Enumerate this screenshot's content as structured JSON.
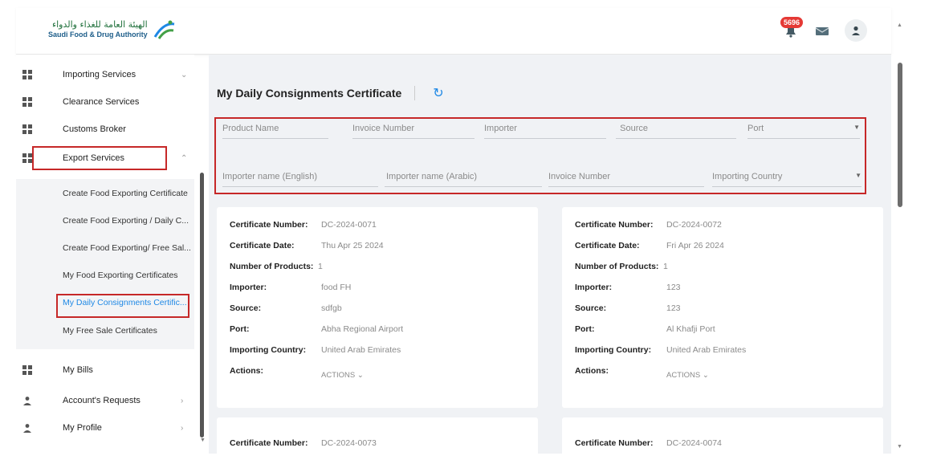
{
  "header": {
    "logo_ar": "الهيئة العامة للغذاء والدواء",
    "logo_en": "Saudi Food & Drug Authority",
    "notification_count": "5696",
    "icons": [
      "bell-icon",
      "mail-icon",
      "user-icon"
    ]
  },
  "sidebar": {
    "items": [
      {
        "label": "Importing Services",
        "chevron": "⌄"
      },
      {
        "label": "Clearance Services",
        "chevron": ""
      },
      {
        "label": "Customs Broker",
        "chevron": ""
      },
      {
        "label": "Export Services",
        "chevron": "⌃"
      },
      {
        "label": "My Bills",
        "chevron": ""
      },
      {
        "label": "Account's Requests",
        "chevron": "›"
      },
      {
        "label": "My Profile",
        "chevron": "›"
      }
    ],
    "sub_items": [
      "Create Food Exporting Certificate",
      "Create Food Exporting / Daily C...",
      "Create Food Exporting/ Free Sal...",
      "My Food Exporting Certificates",
      "My Daily Consignments Certific...",
      "My Free Sale Certificates"
    ]
  },
  "main": {
    "title": "My Daily Consignments Certificate",
    "filters_row1": [
      "Product Name",
      "Invoice Number",
      "Importer",
      "Source",
      "Port"
    ],
    "filters_row2": [
      "Importer name (English)",
      "Importer name (Arabic)",
      "Invoice Number",
      "Importing Country"
    ],
    "labels": {
      "cert_number": "Certificate Number:",
      "cert_date": "Certificate Date:",
      "num_products": "Number of Products:",
      "importer": "Importer:",
      "source": "Source:",
      "port": "Port:",
      "country": "Importing Country:",
      "actions": "Actions:",
      "actions_btn": "ACTIONS ⌄"
    },
    "cards": [
      {
        "number": "DC-2024-0071",
        "date": "Thu Apr 25 2024",
        "products": "1",
        "importer": "food FH",
        "source": "sdfgb",
        "port": "Abha Regional Airport",
        "country": "United Arab Emirates"
      },
      {
        "number": "DC-2024-0072",
        "date": "Fri Apr 26 2024",
        "products": "1",
        "importer": "123",
        "source": "123",
        "port": "Al Khafji Port",
        "country": "United Arab Emirates"
      },
      {
        "number": "DC-2024-0073"
      },
      {
        "number": "DC-2024-0074"
      }
    ]
  },
  "colors": {
    "accent": "#1e88e5",
    "highlight": "#c62828",
    "badge": "#e53935"
  }
}
